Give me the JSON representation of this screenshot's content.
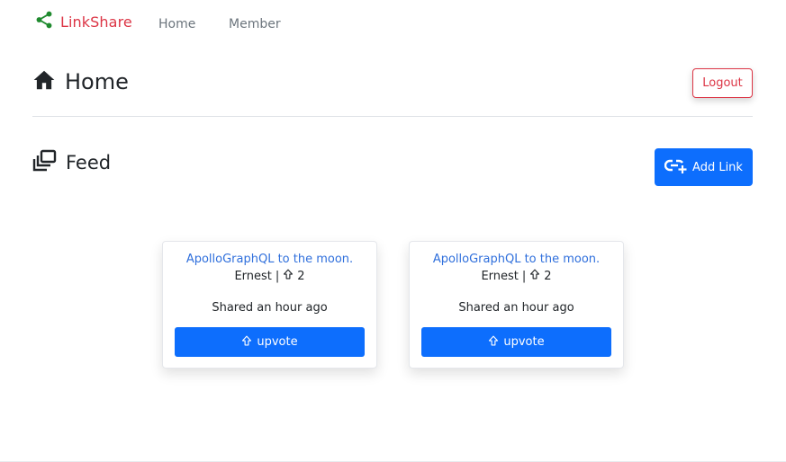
{
  "nav": {
    "brand": "LinkShare",
    "links": [
      "Home",
      "Member"
    ]
  },
  "header": {
    "title": "Home",
    "logout_label": "Logout"
  },
  "feed": {
    "title": "Feed",
    "add_link_label": "Add Link",
    "cards": [
      {
        "title": "ApolloGraphQL to the moon.",
        "author": "Ernest",
        "separator": "|",
        "votes": "2",
        "time": "Shared an hour ago",
        "upvote_label": "upvote"
      },
      {
        "title": "ApolloGraphQL to the moon.",
        "author": "Ernest",
        "separator": "|",
        "votes": "2",
        "time": "Shared an hour ago",
        "upvote_label": "upvote"
      }
    ]
  },
  "colors": {
    "brand_icon": "#1f8a2e",
    "brand_text": "#dc3545",
    "primary": "#0d6efd",
    "danger": "#dc3545",
    "link": "#2f6fdc"
  },
  "icons": {
    "brand": "share-icon",
    "home": "house-icon",
    "feed": "collection-icon",
    "add_link": "link-plus-icon",
    "vote": "arrow-up-icon"
  }
}
